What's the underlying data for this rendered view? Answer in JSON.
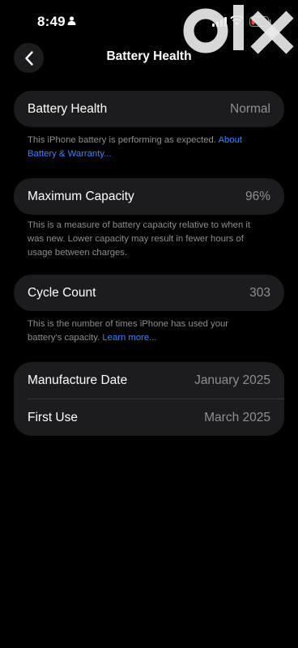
{
  "status_bar": {
    "time": "8:49",
    "watermark": "olx"
  },
  "nav": {
    "title": "Battery Health"
  },
  "battery_health": {
    "label": "Battery Health",
    "value": "Normal",
    "footnote": "This iPhone battery is performing as expected. ",
    "footnote_link": "About Battery & Warranty..."
  },
  "maximum_capacity": {
    "label": "Maximum Capacity",
    "value": "96%",
    "footnote": "This is a measure of battery capacity relative to when it was new. Lower capacity may result in fewer hours of usage between charges."
  },
  "cycle_count": {
    "label": "Cycle Count",
    "value": "303",
    "footnote": "This is the number of times iPhone has used your battery's capacity. ",
    "footnote_link": "Learn more..."
  },
  "dates": {
    "manufacture_label": "Manufacture Date",
    "manufacture_value": "January 2025",
    "first_use_label": "First Use",
    "first_use_value": "March 2025"
  },
  "colors": {
    "background": "#000000",
    "card": "#1c1c1e",
    "secondary_text": "#8e8e93",
    "link": "#3a84ff",
    "battery_low": "#ff3b30"
  }
}
